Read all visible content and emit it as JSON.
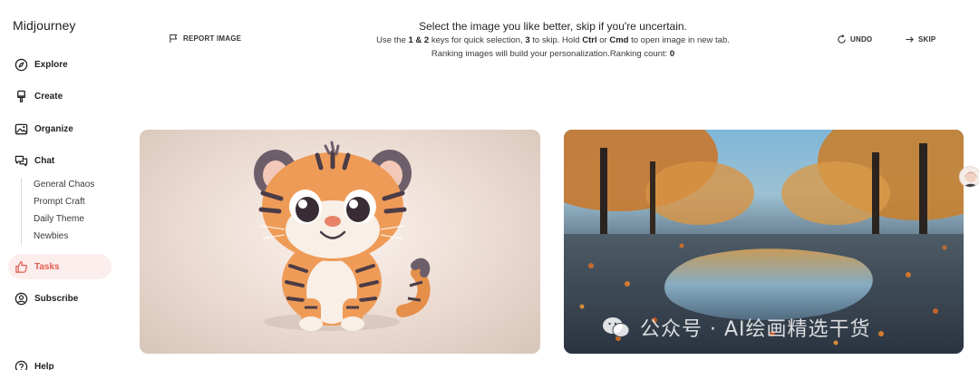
{
  "app": {
    "logo": "Midjourney"
  },
  "sidebar": {
    "items": [
      {
        "label": "Explore",
        "icon": "compass-icon"
      },
      {
        "label": "Create",
        "icon": "paintbrush-icon"
      },
      {
        "label": "Organize",
        "icon": "image-icon"
      },
      {
        "label": "Chat",
        "icon": "chat-bubbles-icon"
      },
      {
        "label": "Tasks",
        "icon": "thumbs-up-icon",
        "active": true
      },
      {
        "label": "Subscribe",
        "icon": "user-circle-icon"
      },
      {
        "label": "Help",
        "icon": "help-circle-icon"
      }
    ],
    "chat_channels": [
      "General Chaos",
      "Prompt Craft",
      "Daily Theme",
      "Newbies"
    ],
    "accent_color": "#e35d4f"
  },
  "header": {
    "report_label": "REPORT IMAGE",
    "title": "Select the image you like better, skip if you're uncertain.",
    "line2": {
      "p1": "Use the ",
      "k1": "1 & 2",
      "p2": " keys for quick selection, ",
      "k2": "3",
      "p3": " to skip. Hold ",
      "k3": "Ctrl",
      "p4": " or ",
      "k4": "Cmd",
      "p5": " to open image in new tab."
    },
    "line3": {
      "p1": "Ranking images will build your personalization.Ranking count: ",
      "count": "0"
    },
    "undo_label": "UNDO",
    "skip_label": "SKIP"
  },
  "images": {
    "left": {
      "subject": "cute cartoon tiger cub sitting"
    },
    "right": {
      "subject": "autumn tree-lined road with puddle reflection"
    }
  },
  "watermark": {
    "text": "公众号 · AI绘画精选干货"
  }
}
